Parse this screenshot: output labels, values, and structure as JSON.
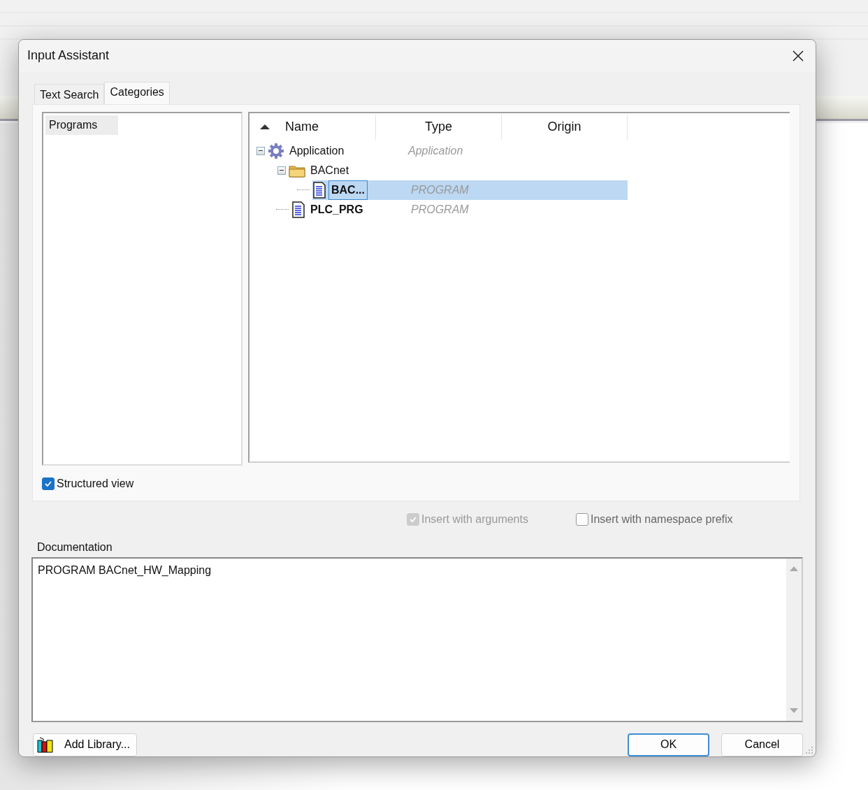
{
  "window": {
    "title": "Input Assistant"
  },
  "tabs": [
    {
      "label": "Text Search",
      "selected": false
    },
    {
      "label": "Categories",
      "selected": true
    }
  ],
  "categories": [
    {
      "label": "Programs",
      "selected": true
    }
  ],
  "structured_view": {
    "label": "Structured view",
    "checked": true
  },
  "tree": {
    "columns": [
      "Name",
      "Type",
      "Origin"
    ],
    "rows": [
      {
        "kind": "application",
        "name": "Application",
        "type": "Application",
        "expanded": true,
        "selected": false,
        "children": [
          {
            "kind": "folder",
            "name": "BACnet",
            "expanded": true,
            "selected": false,
            "children": [
              {
                "kind": "program",
                "name": "BAC...",
                "type": "PROGRAM",
                "selected": true
              }
            ]
          },
          {
            "kind": "program",
            "name": "PLC_PRG",
            "type": "PROGRAM",
            "selected": false
          }
        ]
      }
    ]
  },
  "options": [
    {
      "label": "Insert with arguments",
      "checked": true,
      "disabled": true
    },
    {
      "label": "Insert with namespace prefix",
      "checked": false,
      "disabled": false
    }
  ],
  "documentation": {
    "label": "Documentation",
    "text": "PROGRAM BACnet_HW_Mapping"
  },
  "buttons": [
    {
      "kind": "library",
      "label": "Add Library..."
    },
    {
      "kind": "default",
      "label": "OK"
    },
    {
      "kind": "normal",
      "label": "Cancel"
    }
  ]
}
